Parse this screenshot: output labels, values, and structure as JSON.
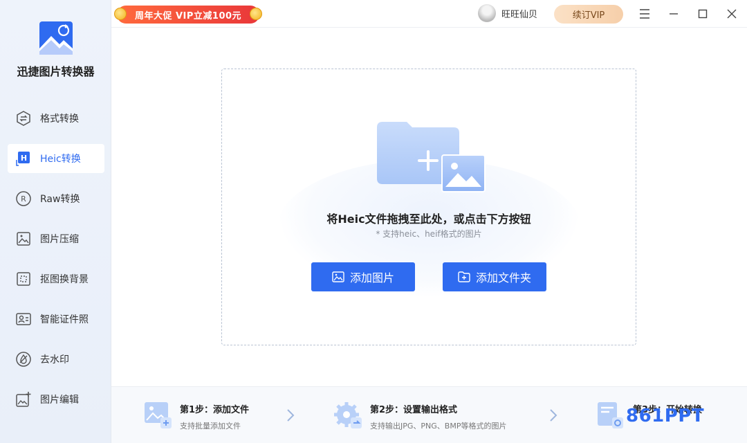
{
  "app": {
    "name": "迅捷图片转换器"
  },
  "sidebar": {
    "items": [
      {
        "label": "格式转换",
        "icon": "format-convert-icon"
      },
      {
        "label": "Heic转换",
        "icon": "heic-icon",
        "active": true
      },
      {
        "label": "Raw转换",
        "icon": "raw-icon"
      },
      {
        "label": "图片压缩",
        "icon": "image-compress-icon"
      },
      {
        "label": "抠图换背景",
        "icon": "cutout-icon"
      },
      {
        "label": "智能证件照",
        "icon": "id-photo-icon"
      },
      {
        "label": "去水印",
        "icon": "watermark-remove-icon"
      },
      {
        "label": "图片编辑",
        "icon": "image-edit-icon"
      }
    ]
  },
  "topbar": {
    "promo": "周年大促 VIP立减100元",
    "username": "旺旺仙贝",
    "vip_button": "续订VIP"
  },
  "dropzone": {
    "title": "将Heic文件拖拽至此处，或点击下方按钮",
    "subtitle": "* 支持heic、heif格式的图片",
    "add_image": "添加图片",
    "add_folder": "添加文件夹"
  },
  "steps": [
    {
      "title": "第1步：添加文件",
      "desc": "支持批量添加文件"
    },
    {
      "title": "第2步：设置输出格式",
      "desc": "支持输出JPG、PNG、BMP等格式的图片"
    },
    {
      "title": "第3步：开始转换",
      "desc": ""
    }
  ],
  "watermark": "861PPT",
  "colors": {
    "accent": "#2f6bf0",
    "promo": "#e9373a",
    "vip": "#f6cfaa"
  }
}
